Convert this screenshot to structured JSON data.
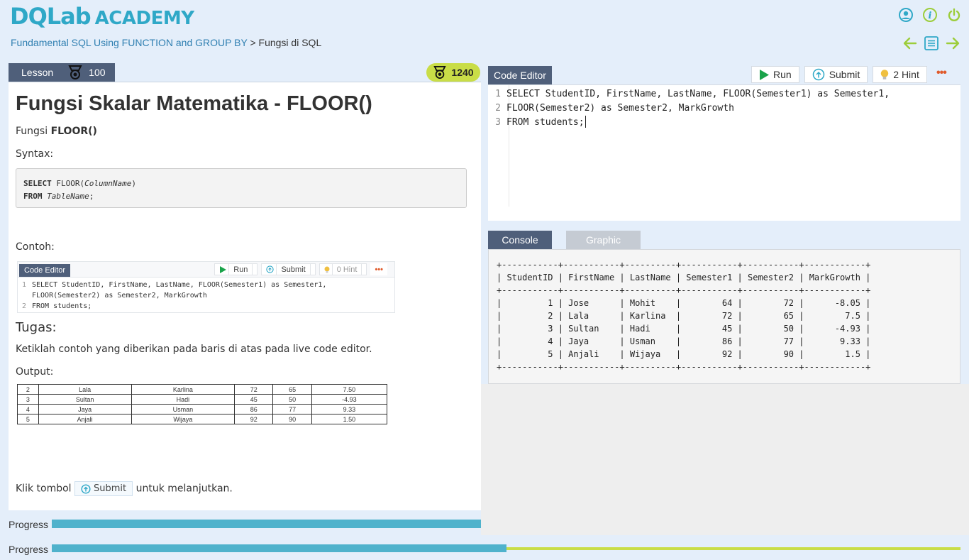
{
  "brand": {
    "logo_text": "DQLab",
    "logo_suffix": "ACADEMY",
    "color": "#2fa8c7"
  },
  "header": {
    "icons": [
      "user-icon",
      "info-icon",
      "power-icon"
    ]
  },
  "breadcrumb": {
    "course": "Fundamental SQL Using FUNCTION and GROUP BY",
    "separator": ">",
    "lesson": "Fungsi di SQL"
  },
  "nav": {
    "icons": [
      "arrow-left-icon",
      "list-icon",
      "arrow-right-icon"
    ],
    "color": "#9ccd3b"
  },
  "lesson": {
    "tab_label": "Lesson",
    "tab_points": "100",
    "total_points": "1240",
    "title": "Fungsi Skalar Matematika - FLOOR()",
    "intro_prefix": "Fungsi ",
    "intro_bold": "FLOOR()",
    "syntax_label": "Syntax:",
    "syntax": {
      "kw1": "SELECT",
      "fn": " FLOOR(",
      "arg": "ColumnName",
      "close": ")",
      "kw2": "FROM",
      "table": "TableName",
      "end": ";"
    },
    "example_label": "Contoh:",
    "example": {
      "tab": "Code Editor",
      "run": "Run",
      "submit": "Submit",
      "hint": "0 Hint",
      "lines": [
        {
          "n": "1",
          "t": "SELECT  StudentID, FirstName, LastName, FLOOR(Semester1) as Semester1,"
        },
        {
          "n": "",
          "t": "FLOOR(Semester2) as Semester2, MarkGrowth"
        },
        {
          "n": "2",
          "t": "FROM students;"
        }
      ]
    },
    "task_heading": "Tugas:",
    "task_text": "Ketiklah contoh yang diberikan pada baris di atas pada live code editor.",
    "output_label": "Output:",
    "output_rows": [
      [
        "2",
        "Lala",
        "Karlina",
        "72",
        "65",
        "7.50"
      ],
      [
        "3",
        "Sultan",
        "Hadi",
        "45",
        "50",
        "-4.93"
      ],
      [
        "4",
        "Jaya",
        "Usman",
        "86",
        "77",
        "9.33"
      ],
      [
        "5",
        "Anjali",
        "Wijaya",
        "92",
        "90",
        "1.50"
      ]
    ],
    "click_prefix": "Klik tombol",
    "click_button": "Submit",
    "click_suffix": "untuk melanjutkan."
  },
  "progress": [
    {
      "label": "Progress",
      "value_pct": 100
    },
    {
      "label": "Progress",
      "value_pct": 50
    }
  ],
  "editor": {
    "tab": "Code Editor",
    "run": "Run",
    "submit": "Submit",
    "hint": "2 Hint",
    "more": "•••",
    "lines": [
      {
        "n": "1",
        "t": "SELECT StudentID, FirstName, LastName, FLOOR(Semester1) as Semester1,"
      },
      {
        "n": "2",
        "t": "FLOOR(Semester2) as Semester2, MarkGrowth"
      },
      {
        "n": "3",
        "t": "FROM students;"
      }
    ]
  },
  "console": {
    "tab_console": "Console",
    "tab_graphic": "Graphic",
    "output": "+-----------+-----------+----------+-----------+-----------+------------+\n| StudentID | FirstName | LastName | Semester1 | Semester2 | MarkGrowth |\n+-----------+-----------+----------+-----------+-----------+------------+\n|         1 | Jose      | Mohit    |        64 |        72 |      -8.05 |\n|         2 | Lala      | Karlina  |        72 |        65 |        7.5 |\n|         3 | Sultan    | Hadi     |        45 |        50 |      -4.93 |\n|         4 | Jaya      | Usman    |        86 |        77 |       9.33 |\n|         5 | Anjali    | Wijaya   |        92 |        90 |        1.5 |\n+-----------+-----------+----------+-----------+-----------+------------+"
  }
}
